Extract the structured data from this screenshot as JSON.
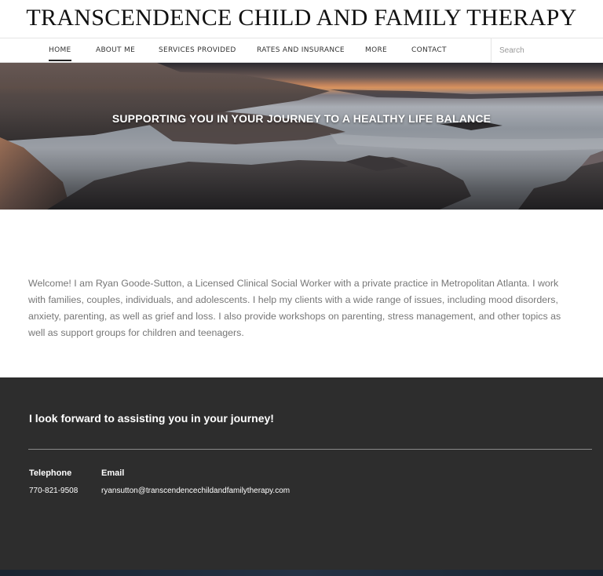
{
  "site": {
    "title": "TRANSCENDENCE CHILD AND FAMILY THERAPY"
  },
  "nav": {
    "items": [
      {
        "label": "HOME",
        "active": true
      },
      {
        "label": "ABOUT ME"
      },
      {
        "label": "SERVICES PROVIDED"
      },
      {
        "label": "RATES AND INSURANCE"
      },
      {
        "label": "MORE"
      },
      {
        "label": "CONTACT"
      }
    ],
    "search_placeholder": "Search"
  },
  "hero": {
    "tagline": "SUPPORTING YOU IN YOUR JOURNEY TO A HEALTHY LIFE BALANCE"
  },
  "intro": {
    "text": "Welcome! I am Ryan Goode-Sutton, a Licensed Clinical Social Worker with a private practice in Metropolitan Atlanta. I work with families, couples, individuals, and adolescents. I help my clients with a wide range of issues, including mood disorders, anxiety, parenting, as well as grief and loss. I also provide workshops on parenting, stress management, and other topics as well as support groups for children and teenagers."
  },
  "footer": {
    "heading": "I look forward to assisting you in your journey!",
    "telephone_label": "Telephone",
    "telephone_value": "770-821-9508",
    "email_label": "Email",
    "email_value": "ryansutton@transcendencechildandfamilytherapy.com"
  },
  "colors": {
    "footer_bg": "#2d2d2d",
    "body_text": "#777777",
    "nav_active_underline": "#222222"
  }
}
